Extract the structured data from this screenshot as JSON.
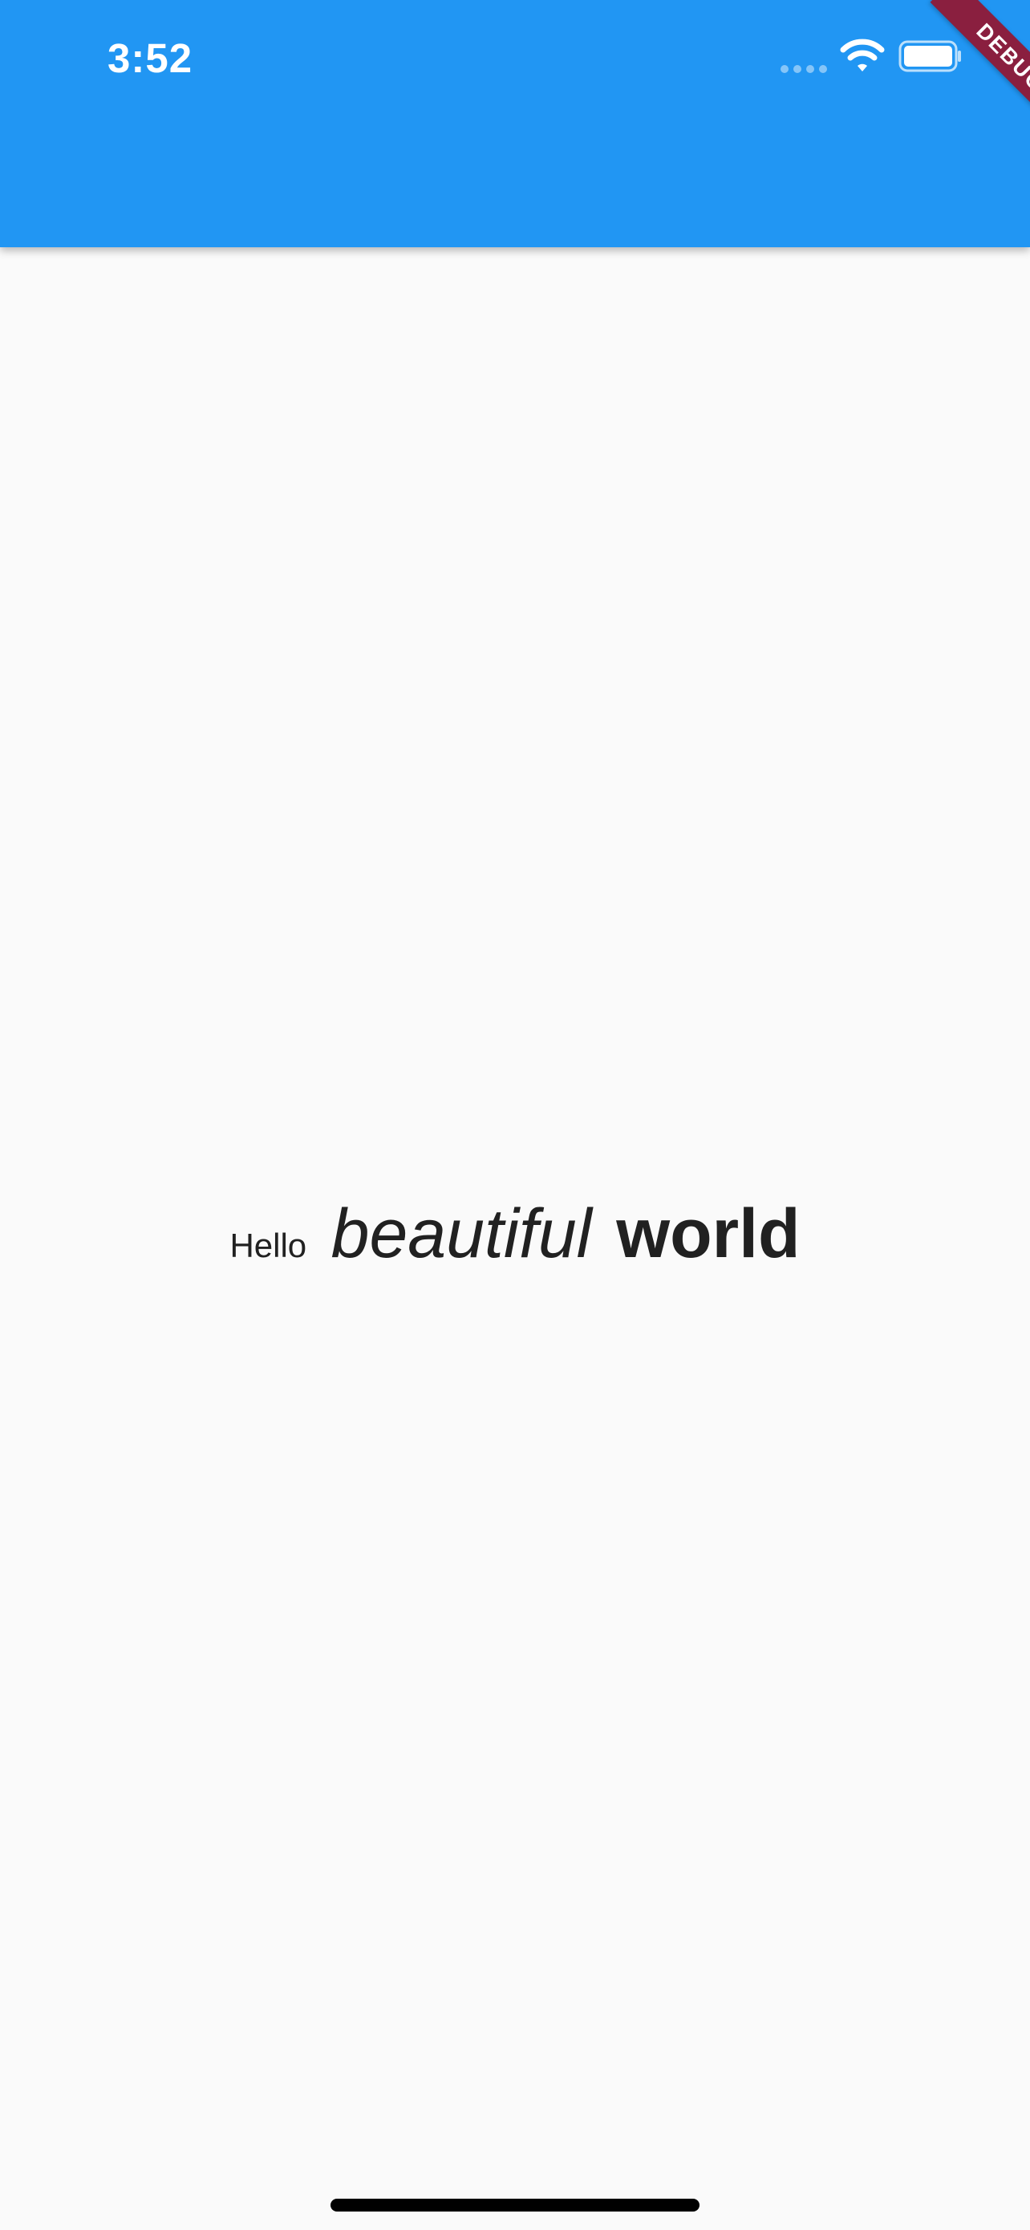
{
  "status_bar": {
    "time": "3:52",
    "icons": [
      "signal-icon",
      "wifi-icon",
      "battery-icon"
    ]
  },
  "app_bar": {
    "color": "#2196f3"
  },
  "debug_banner": {
    "label": "DEBUG",
    "color": "#8a1f3f"
  },
  "body": {
    "background": "#fafafa",
    "rich_text": {
      "part1": "Hello",
      "part2": "beautiful",
      "part3": "world"
    }
  }
}
